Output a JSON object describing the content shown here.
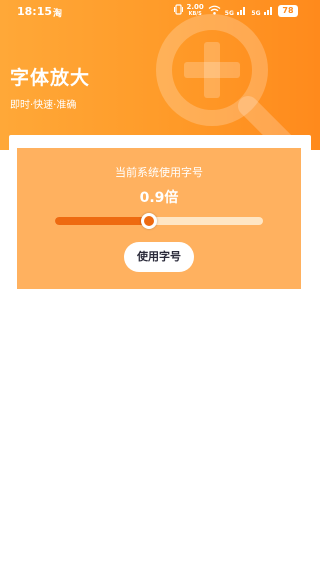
{
  "status_bar": {
    "time": "18:15",
    "app_indicator": "淘",
    "net_speed_value": "2.00",
    "net_speed_unit": "KB/S",
    "signal1_label": "5G",
    "signal2_label": "5G",
    "battery": "78"
  },
  "header": {
    "title": "字体放大",
    "subtitle": "即时·快速·准确"
  },
  "font_card": {
    "label": "当前系统使用字号",
    "value_text": "0.9倍",
    "slider_fraction": 0.45,
    "apply_label": "使用字号"
  },
  "colors": {
    "header_start": "#ffa838",
    "header_end": "#ff8a1c",
    "card_bg": "#ffb15f",
    "slider_fill": "#ee6a10",
    "slider_track": "#ffe6c4"
  },
  "icons": [
    "vibrate-icon",
    "wifi-icon",
    "signal-icon",
    "battery-icon",
    "zoom-plus-icon"
  ]
}
